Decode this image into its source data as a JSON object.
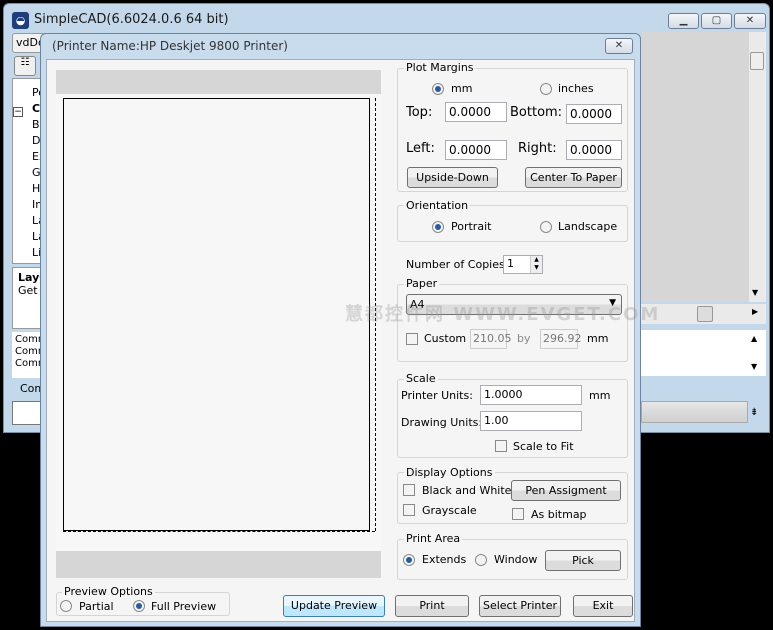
{
  "main_window": {
    "title": "SimpleCAD(6.6024.0.6  64 bit)",
    "combo": "vdDo",
    "tree": [
      "Po",
      "Co",
      "Blo",
      "Dir",
      "Ex",
      "Gr",
      "Ha",
      "Im",
      "La",
      "La",
      "Lig"
    ],
    "info_title": "LayO",
    "info_text": "Get t",
    "commands": [
      "Comm",
      "Comm",
      "Comm"
    ],
    "command_label": "Com"
  },
  "dialog": {
    "title": "(Printer Name:HP Deskjet 9800 Printer)",
    "plot_margins": {
      "label": "Plot Margins",
      "unit_mm": "mm",
      "unit_inches": "inches",
      "selected_unit": "mm",
      "top_label": "Top:",
      "top": "0.0000",
      "bottom_label": "Bottom:",
      "bottom": "0.0000",
      "left_label": "Left:",
      "left": "0.0000",
      "right_label": "Right:",
      "right": "0.0000",
      "upside_down": "Upside-Down",
      "center_to_paper": "Center To Paper"
    },
    "orientation": {
      "label": "Orientation",
      "portrait": "Portrait",
      "landscape": "Landscape",
      "selected": "Portrait"
    },
    "copies": {
      "label": "Number of Copies :",
      "value": "1"
    },
    "paper": {
      "label": "Paper",
      "size": "A4",
      "custom_label": "Custom",
      "custom_checked": false,
      "width": "210.05",
      "by": "by",
      "height": "296.92",
      "unit": "mm"
    },
    "scale": {
      "label": "Scale",
      "printer_units_label": "Printer Units:",
      "printer_units": "1.0000",
      "unit": "mm",
      "drawing_units_label": "Drawing Units:",
      "drawing_units": "1.00",
      "scale_to_fit": "Scale to Fit",
      "scale_to_fit_checked": false
    },
    "display_options": {
      "label": "Display Options",
      "black_white": "Black and White",
      "grayscale": "Grayscale",
      "as_bitmap": "As bitmap",
      "pen_assignment": "Pen Assigment"
    },
    "print_area": {
      "label": "Print Area",
      "extends": "Extends",
      "window": "Window",
      "pick": "Pick",
      "selected": "Extends"
    },
    "preview_options": {
      "label": "Preview Options",
      "partial": "Partial",
      "full": "Full Preview",
      "selected": "Full Preview"
    },
    "buttons": {
      "update_preview": "Update Preview",
      "print": "Print",
      "select_printer": "Select Printer",
      "exit": "Exit"
    }
  },
  "watermark": "慧都控件网 WWW.EVGET.COM"
}
